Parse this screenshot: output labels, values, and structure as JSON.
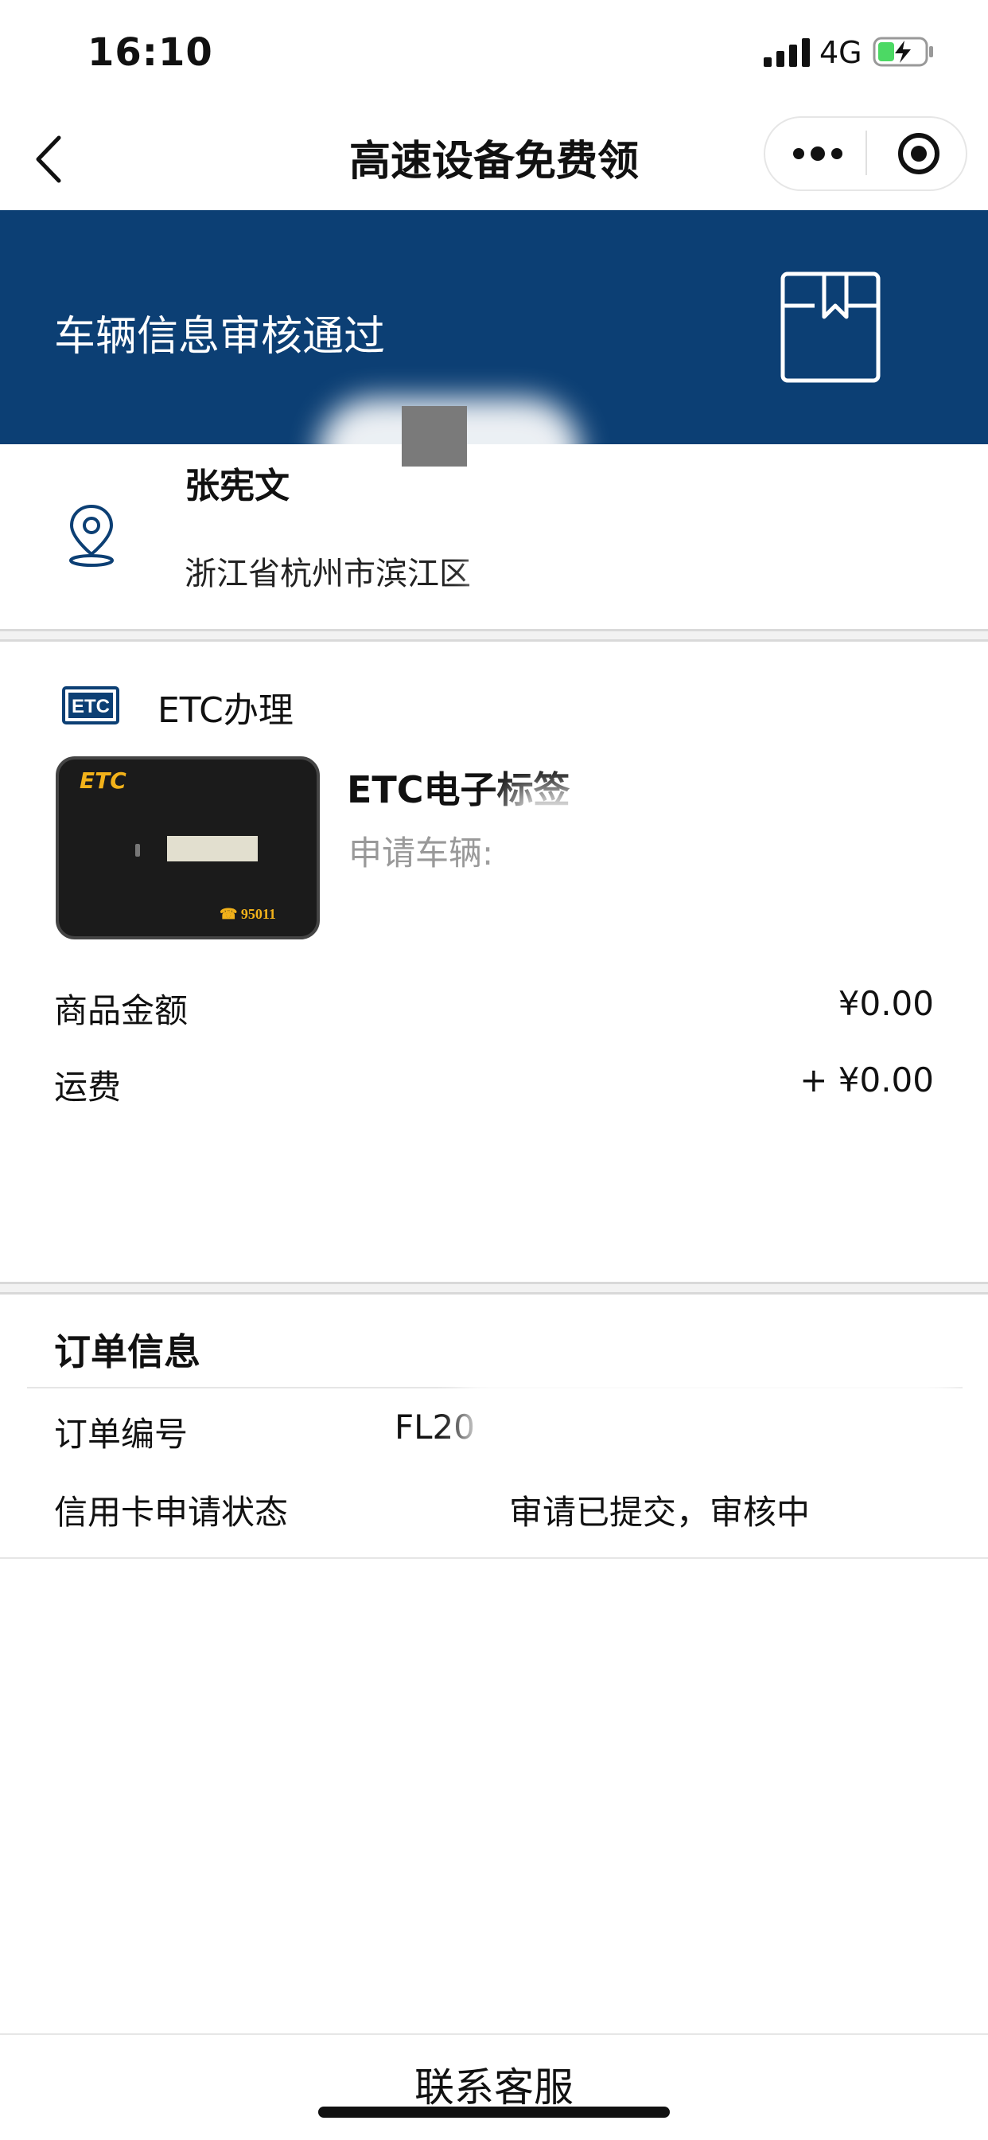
{
  "status_bar": {
    "time": "16:10",
    "network": "4G"
  },
  "nav": {
    "title": "高速设备免费领"
  },
  "banner": {
    "text": "车辆信息审核通过",
    "background": "#0c3f74"
  },
  "address": {
    "name": "张宪文",
    "text": "浙江省杭州市滨江区"
  },
  "etc": {
    "section_label": "ETC办理",
    "product_name": "ETC电子标签",
    "vehicle_label": "申请车辆:",
    "card": {
      "brand": "ETC",
      "phone": "☎ 95011"
    }
  },
  "fees": {
    "goods_label": "商品金额",
    "goods_value": "¥0.00",
    "shipping_label": "运费",
    "shipping_value": "+ ¥0.00"
  },
  "order": {
    "title": "订单信息",
    "number_label": "订单编号",
    "number_value": "FL20",
    "status_label": "信用卡申请状态",
    "status_value": "审请已提交，审核中"
  },
  "bottom": {
    "contact_label": "联系客服"
  }
}
